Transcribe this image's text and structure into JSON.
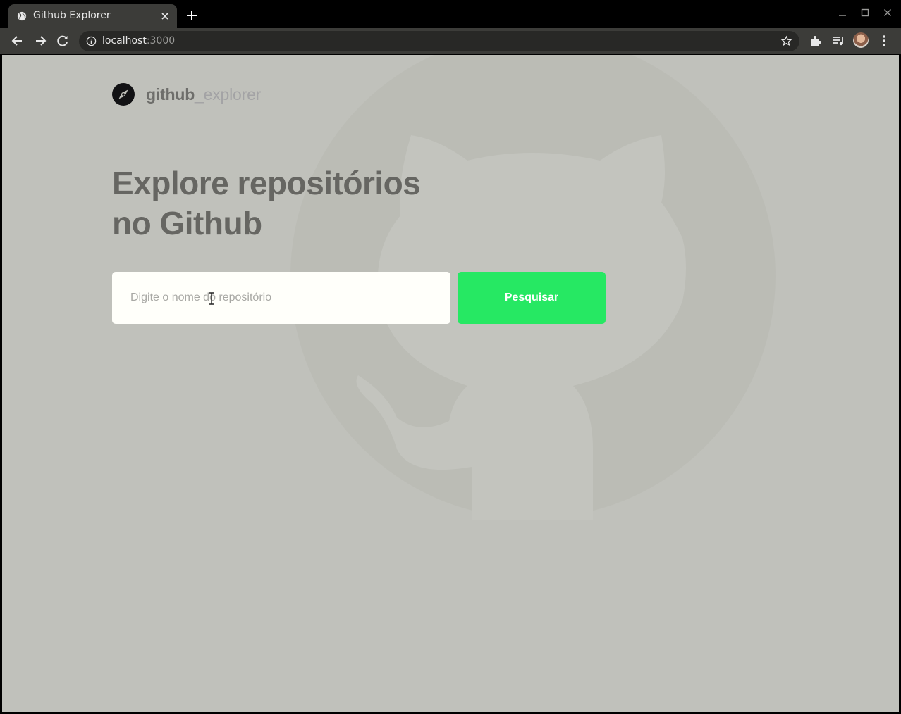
{
  "browser": {
    "tab_title": "Github Explorer",
    "url_host": "localhost",
    "url_port": ":3000"
  },
  "page": {
    "brand_main": "github",
    "brand_suffix": "_explorer",
    "headline_line1": "Explore repositórios",
    "headline_line2": "no Github",
    "search_placeholder": "Digite o nome do repositório",
    "search_value": "",
    "search_button_label": "Pesquisar"
  },
  "colors": {
    "page_background": "#c0c1bb",
    "accent_button": "#26e863",
    "headline": "#666662",
    "input_background": "#fffffa"
  },
  "icons": [
    "globe-icon",
    "close-icon",
    "plus-icon",
    "minimize-icon",
    "maximize-icon",
    "back-icon",
    "forward-icon",
    "reload-icon",
    "info-icon",
    "star-icon",
    "extensions-icon",
    "media-icon",
    "menu-icon",
    "compass-icon",
    "github-octocat-icon",
    "text-cursor-icon"
  ]
}
